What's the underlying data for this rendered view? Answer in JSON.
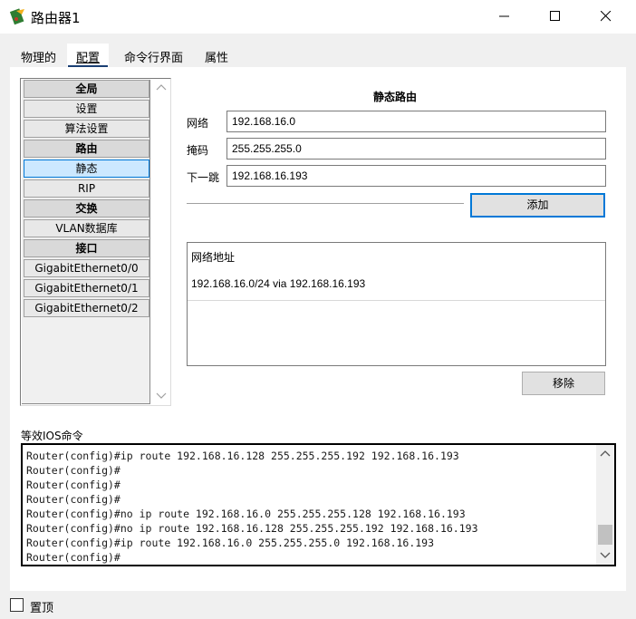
{
  "window": {
    "title": "路由器1",
    "icon": "router-icon",
    "controls": [
      "minimize-icon",
      "maximize-icon",
      "close-icon"
    ]
  },
  "tabs": [
    {
      "label": "物理的",
      "active": false
    },
    {
      "label": "配置",
      "active": true
    },
    {
      "label": "命令行界面",
      "active": false
    },
    {
      "label": "属性",
      "active": false
    }
  ],
  "sidebar": {
    "items": [
      {
        "label": "全局",
        "type": "header"
      },
      {
        "label": "设置",
        "type": "item"
      },
      {
        "label": "算法设置",
        "type": "item"
      },
      {
        "label": "路由",
        "type": "header"
      },
      {
        "label": "静态",
        "type": "item",
        "selected": true
      },
      {
        "label": "RIP",
        "type": "item"
      },
      {
        "label": "交换",
        "type": "header"
      },
      {
        "label": "VLAN数据库",
        "type": "item"
      },
      {
        "label": "接口",
        "type": "header"
      },
      {
        "label": "GigabitEthernet0/0",
        "type": "item"
      },
      {
        "label": "GigabitEthernet0/1",
        "type": "item"
      },
      {
        "label": "GigabitEthernet0/2",
        "type": "item"
      }
    ]
  },
  "static_route": {
    "title": "静态路由",
    "network_label": "网络",
    "network_value": "192.168.16.0",
    "mask_label": "掩码",
    "mask_value": "255.255.255.0",
    "nexthop_label": "下一跳",
    "nexthop_value": "192.168.16.193",
    "add_button": "添加",
    "table_header": "网络地址",
    "routes": [
      "192.168.16.0/24 via 192.168.16.193"
    ],
    "remove_button": "移除"
  },
  "ios": {
    "label": "等效IOS命令",
    "lines": [
      "Router(config)#ip route 192.168.16.128 255.255.255.192 192.168.16.193",
      "Router(config)#",
      "Router(config)#",
      "Router(config)#",
      "Router(config)#no ip route 192.168.16.0 255.255.255.128 192.168.16.193",
      "Router(config)#no ip route 192.168.16.128 255.255.255.192 192.168.16.193",
      "Router(config)#ip route 192.168.16.0 255.255.255.0 192.168.16.193",
      "Router(config)#"
    ]
  },
  "footer": {
    "topmost_label": "置顶",
    "topmost_checked": false
  },
  "colors": {
    "accent": "#0078d7",
    "selected_bg": "#cce8ff",
    "tab_underline": "#1a3f73"
  }
}
